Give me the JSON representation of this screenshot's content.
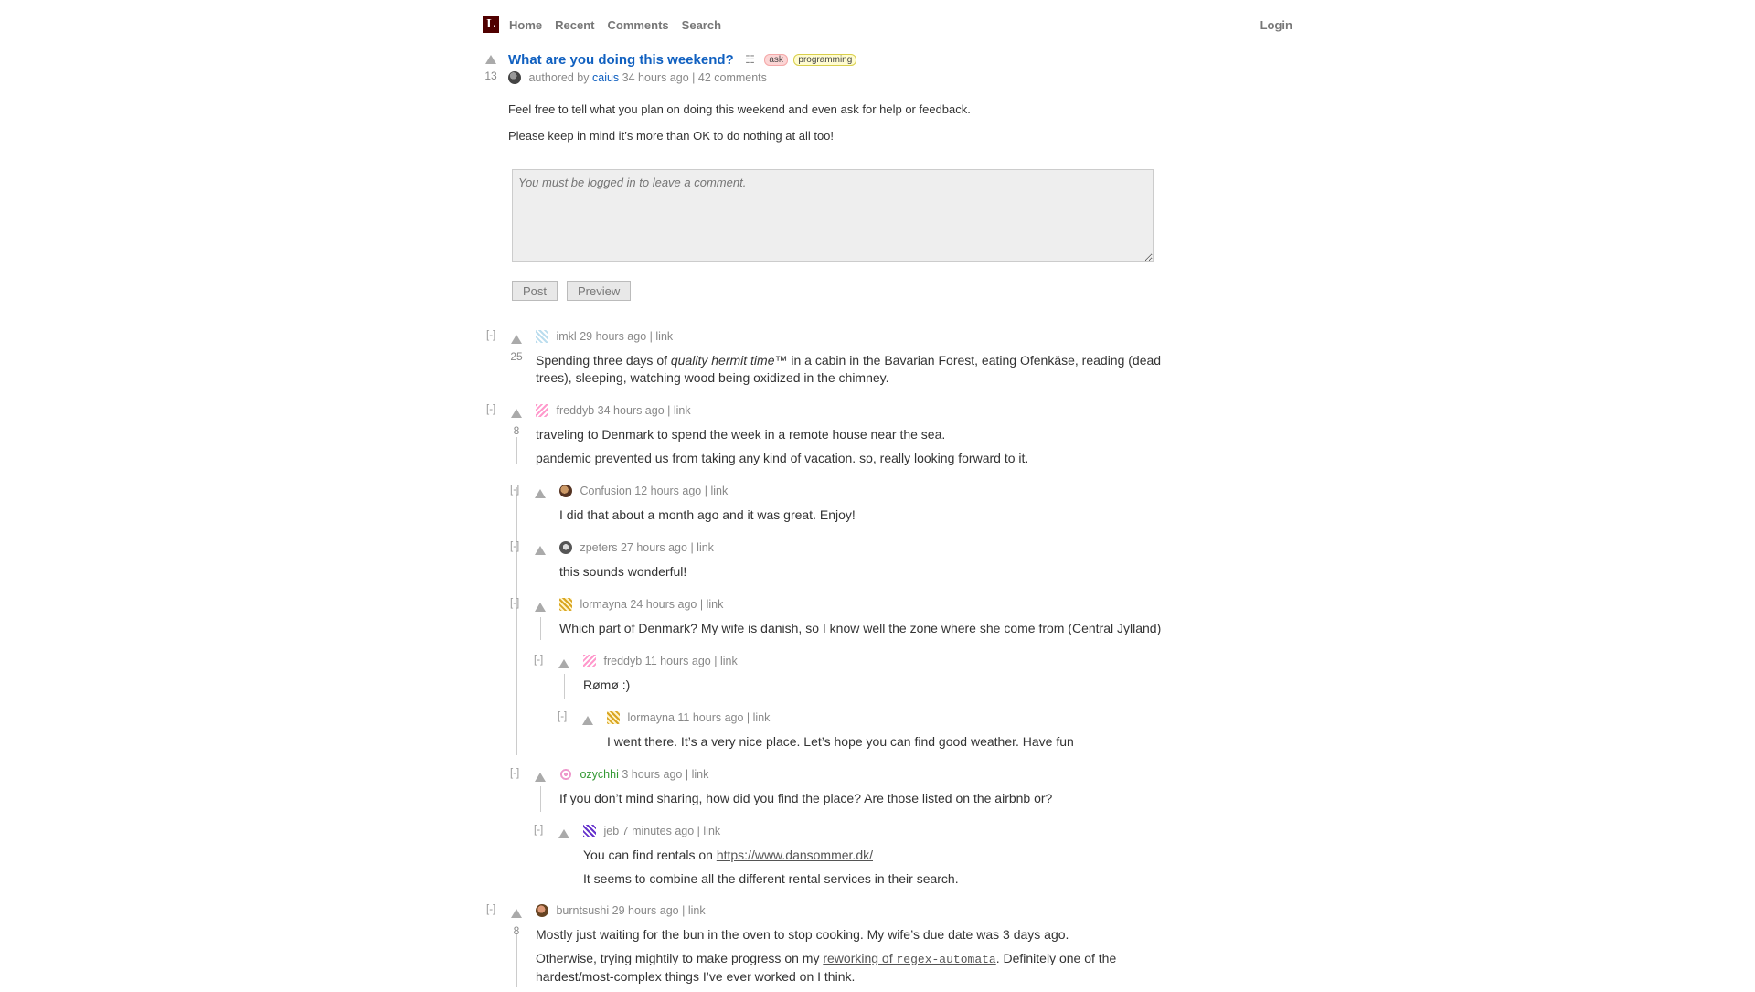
{
  "header": {
    "logo_letter": "L",
    "nav": [
      "Home",
      "Recent",
      "Comments",
      "Search"
    ],
    "login": "Login"
  },
  "story": {
    "score": "13",
    "title": "What are you doing this weekend?",
    "tags": [
      "ask",
      "programming"
    ],
    "byline_prefix": "authored by",
    "author": "caius",
    "time": "34 hours ago",
    "comments": "42 comments",
    "text": [
      "Feel free to tell what you plan on doing this weekend and even ask for help or feedback.",
      "Please keep in mind it’s more than OK to do nothing at all too!"
    ]
  },
  "comment_form": {
    "placeholder": "You must be logged in to leave a comment.",
    "post": "Post",
    "preview": "Preview"
  },
  "comments": [
    {
      "user": "imkl",
      "time": "29 hours ago",
      "score": "25",
      "body1_pre": "Spending three days of ",
      "body1_em": "quality hermit time",
      "body1_post": "™ in a cabin in the Bavarian Forest, eating Ofenkäse, reading (dead",
      "body2": "trees), sleeping, watching wood being oxidized in the chimney."
    },
    {
      "user": "freddyb",
      "time": "34 hours ago",
      "score": "8",
      "body1": "traveling to Denmark to spend the week in a remote house near the sea.",
      "body2": "pandemic prevented us from taking any kind of vacation. so, really looking forward to it."
    },
    {
      "user": "Confusion",
      "time": "12 hours ago",
      "body1": "I did that about a month ago and it was great. Enjoy!"
    },
    {
      "user": "zpeters",
      "time": "27 hours ago",
      "body1": "this sounds wonderful!"
    },
    {
      "user": "lormayna",
      "time": "24 hours ago",
      "body1": "Which part of Denmark? My wife is danish, so I know well the zone where she come from (Central Jylland)"
    },
    {
      "user": "freddyb",
      "time": "11 hours ago",
      "body1": "Rømø :)"
    },
    {
      "user": "lormayna",
      "time": "11 hours ago",
      "body1": "I went there. It’s a very nice place. Let’s hope you can find good weather. Have fun"
    },
    {
      "user": "ozychhi",
      "time": "3 hours ago",
      "body1": "If you don’t mind sharing, how did you find the place? Are those listed on the airbnb or?"
    },
    {
      "user": "jeb",
      "time": "7 minutes ago",
      "body1_pre": "You can find rentals on ",
      "body1_link": "https://www.dansommer.dk/",
      "body2": "It seems to combine all the different rental services in their search."
    },
    {
      "user": "burntsushi",
      "time": "29 hours ago",
      "score": "8",
      "body1": "Mostly just waiting for the bun in the oven to stop cooking. My wife’s due date was 3 days ago.",
      "body2_pre": "Otherwise, trying mightily to make progress on my ",
      "body2_link_text": "reworking of ",
      "body2_link_code": "regex-automata",
      "body2_post": ". Definitely one of the",
      "body3": "hardest/most-complex things I’ve ever worked on I think."
    }
  ],
  "collapse_label": "[-]",
  "link_label": "link",
  "separator": "|",
  "colors": {
    "brand": "#500000",
    "link": "#1060c0",
    "new_user": "#339933"
  }
}
